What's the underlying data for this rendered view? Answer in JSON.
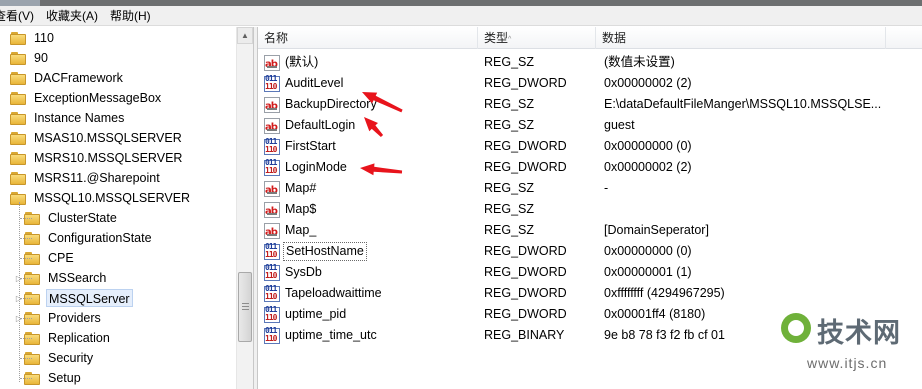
{
  "menu": [
    {
      "label": "查看(V)"
    },
    {
      "label": "收藏夹(A)"
    },
    {
      "label": "帮助(H)"
    }
  ],
  "tree": [
    {
      "label": "110",
      "expandable": false
    },
    {
      "label": "90",
      "expandable": false
    },
    {
      "label": "DACFramework",
      "expandable": false
    },
    {
      "label": "ExceptionMessageBox",
      "expandable": false
    },
    {
      "label": "Instance Names",
      "expandable": false
    },
    {
      "label": "MSAS10.MSSQLSERVER",
      "expandable": false
    },
    {
      "label": "MSRS10.MSSQLSERVER",
      "expandable": false
    },
    {
      "label": "MSRS11.@Sharepoint",
      "expandable": false
    },
    {
      "label": "MSSQL10.MSSQLSERVER",
      "expandable": false
    },
    {
      "label": "ClusterState",
      "expandable": false
    },
    {
      "label": "ConfigurationState",
      "expandable": false
    },
    {
      "label": "CPE",
      "expandable": false
    },
    {
      "label": "MSSearch",
      "expandable": true
    },
    {
      "label": "MSSQLServer",
      "expandable": true,
      "selected": true
    },
    {
      "label": "Providers",
      "expandable": true
    },
    {
      "label": "Replication",
      "expandable": false
    },
    {
      "label": "Security",
      "expandable": false
    },
    {
      "label": "Setup",
      "expandable": false
    }
  ],
  "columns": {
    "name": "名称",
    "type": "类型",
    "data": "数据"
  },
  "values": [
    {
      "name": "(默认)",
      "type": "REG_SZ",
      "data": "(数值未设置)",
      "icon": "string-value-icon"
    },
    {
      "name": "AuditLevel",
      "type": "REG_DWORD",
      "data": "0x00000002 (2)",
      "icon": "binary-value-icon"
    },
    {
      "name": "BackupDirectory",
      "type": "REG_SZ",
      "data": "E:\\dataDefaultFileManger\\MSSQL10.MSSQLSE...",
      "icon": "string-value-icon"
    },
    {
      "name": "DefaultLogin",
      "type": "REG_SZ",
      "data": "guest",
      "icon": "string-value-icon"
    },
    {
      "name": "FirstStart",
      "type": "REG_DWORD",
      "data": "0x00000000 (0)",
      "icon": "binary-value-icon"
    },
    {
      "name": "LoginMode",
      "type": "REG_DWORD",
      "data": "0x00000002 (2)",
      "icon": "binary-value-icon"
    },
    {
      "name": "Map#",
      "type": "REG_SZ",
      "data": "-",
      "icon": "string-value-icon"
    },
    {
      "name": "Map$",
      "type": "REG_SZ",
      "data": "",
      "icon": "string-value-icon"
    },
    {
      "name": "Map_",
      "type": "REG_SZ",
      "data": "[DomainSeperator]",
      "icon": "string-value-icon"
    },
    {
      "name": "SetHostName",
      "type": "REG_DWORD",
      "data": "0x00000000 (0)",
      "icon": "binary-value-icon",
      "focused": true
    },
    {
      "name": "SysDb",
      "type": "REG_DWORD",
      "data": "0x00000001 (1)",
      "icon": "binary-value-icon"
    },
    {
      "name": "Tapeloadwaittime",
      "type": "REG_DWORD",
      "data": "0xffffffff (4294967295)",
      "icon": "binary-value-icon"
    },
    {
      "name": "uptime_pid",
      "type": "REG_DWORD",
      "data": "0x00001ff4 (8180)",
      "icon": "binary-value-icon"
    },
    {
      "name": "uptime_time_utc",
      "type": "REG_BINARY",
      "data": "9e b8 78 f3 f2 fb cf 01",
      "icon": "binary-value-icon"
    }
  ],
  "annotation_color": "#e8141c",
  "watermark": {
    "title": "技术网",
    "url": "www.itjs.cn"
  }
}
